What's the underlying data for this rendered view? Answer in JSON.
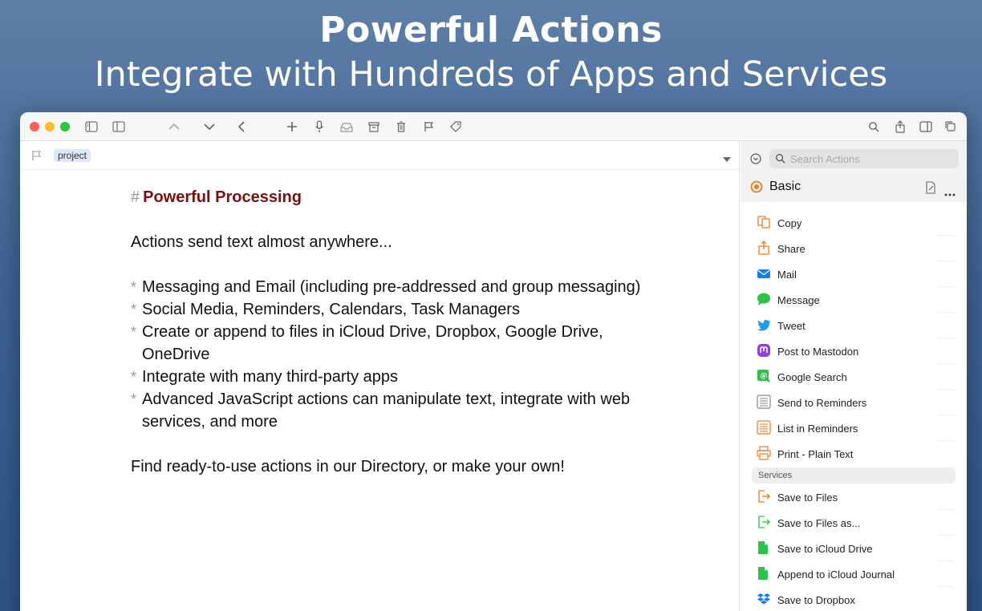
{
  "promo": {
    "title": "Powerful Actions",
    "subtitle": "Integrate with Hundreds of Apps and Services"
  },
  "colors": {
    "accent_orange": "#f07a1e",
    "heading_red": "#7a1010",
    "tag_bg": "#dce8f7"
  },
  "editor": {
    "tag": "project",
    "heading_hash": "#",
    "heading": "Powerful Processing",
    "intro": "Actions send text almost anywhere...",
    "bullets": [
      "Messaging and Email (including pre-addressed and group messaging)",
      "Social Media, Reminders, Calendars, Task Managers",
      "Create or append to files in iCloud Drive, Dropbox, Google Drive, OneDrive",
      "Integrate with many third-party apps",
      "Advanced JavaScript actions can manipulate text, integrate with web services, and more"
    ],
    "bullet_marker": "*",
    "outro": "Find ready-to-use actions in our Directory, or make your own!"
  },
  "panel": {
    "search_placeholder": "Search Actions",
    "group": "Basic",
    "actions": [
      {
        "label": "Copy",
        "icon": "copy-icon"
      },
      {
        "label": "Share",
        "icon": "share-icon"
      },
      {
        "label": "Mail",
        "icon": "mail-icon"
      },
      {
        "label": "Message",
        "icon": "message-icon"
      },
      {
        "label": "Tweet",
        "icon": "twitter-icon"
      },
      {
        "label": "Post to Mastodon",
        "icon": "mastodon-icon"
      },
      {
        "label": "Google Search",
        "icon": "google-search-icon"
      },
      {
        "label": "Send to Reminders",
        "icon": "reminders-icon"
      },
      {
        "label": "List in Reminders",
        "icon": "reminders-list-icon"
      },
      {
        "label": "Print - Plain Text",
        "icon": "print-icon"
      }
    ],
    "section": "Services",
    "services": [
      {
        "label": "Save to Files",
        "icon": "save-files-icon"
      },
      {
        "label": "Save to Files as...",
        "icon": "save-files-as-icon"
      },
      {
        "label": "Save to iCloud Drive",
        "icon": "icloud-drive-icon"
      },
      {
        "label": "Append to iCloud Journal",
        "icon": "icloud-journal-icon"
      },
      {
        "label": "Save to Dropbox",
        "icon": "dropbox-icon"
      }
    ]
  }
}
